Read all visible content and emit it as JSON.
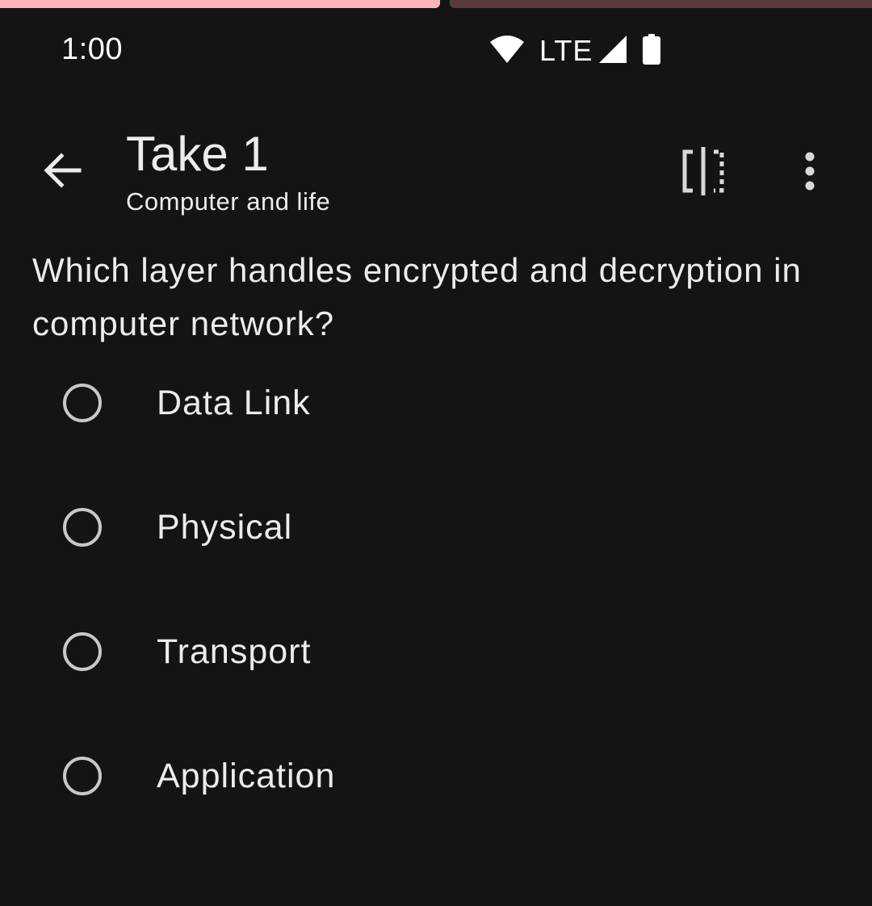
{
  "progress": {
    "current_step": 1,
    "total_steps": 2,
    "active_color": "#ffb3b8",
    "inactive_color": "#5a3c3e"
  },
  "status_bar": {
    "time": "1:00",
    "network": "LTE",
    "icons": [
      "wifi-icon",
      "cell-signal-icon",
      "battery-icon"
    ]
  },
  "app_bar": {
    "title": "Take 1",
    "subtitle": "Computer and life",
    "icons": [
      "arrow-back-icon",
      "split-view-icon",
      "more-vert-icon"
    ]
  },
  "question": {
    "text": "Which layer handles encrypted and decryption in computer network?",
    "options": [
      {
        "label": "Data Link",
        "selected": false
      },
      {
        "label": "Physical",
        "selected": false
      },
      {
        "label": "Transport",
        "selected": false
      },
      {
        "label": "Application",
        "selected": false
      }
    ]
  },
  "colors": {
    "background": "#141414",
    "text": "#ececec",
    "radio_border": "#c8c8c8"
  }
}
